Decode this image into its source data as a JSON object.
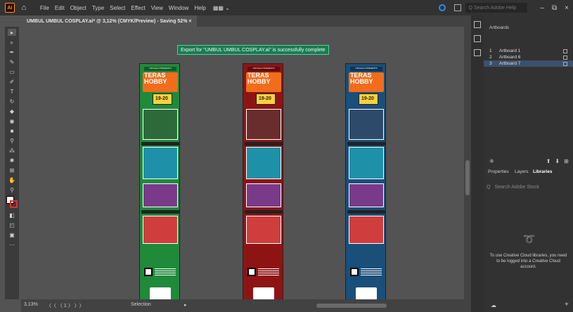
{
  "app": {
    "name": "Adobe Illustrator",
    "logo_text": "Ai",
    "brand_color": "#ff9a00"
  },
  "menubar": {
    "items": [
      "File",
      "Edit",
      "Object",
      "Type",
      "Select",
      "Effect",
      "View",
      "Window",
      "Help"
    ],
    "workspace_label": "▦▦ ⌄",
    "search_placeholder": "Search Adobe Help"
  },
  "document": {
    "tab_title": "UMBUL UMBUL COSPLAY.ai* @ 3,12% (CMYK/Preview)  - Saving 52% ×"
  },
  "notification": {
    "text": "Export for \"UMBUL UMBUL COSPLAY.ai\" is successfully complete"
  },
  "artboards_on_canvas": [
    {
      "color": "#1f8a3a",
      "header": "CIRCLE-D PRESENTS",
      "logo": "TERAS HOBBY",
      "date": "19-20"
    },
    {
      "color": "#8e1414",
      "header": "CIRCLE-D PRESENTS",
      "logo": "TERAS HOBBY",
      "date": "19-20"
    },
    {
      "color": "#1a4f7a",
      "header": "CIRCLE-D PRESENTS",
      "logo": "TERAS HOBBY",
      "date": "19-20"
    }
  ],
  "statusbar": {
    "zoom": "3,13%",
    "page_nav": "〈〈 〈 1 〉 〉〉",
    "tool": "Selection",
    "arrow": "▸"
  },
  "panel": {
    "artboards_title": "Artboards",
    "artboards": [
      {
        "num": "1",
        "name": "Artboard 1",
        "active": false
      },
      {
        "num": "2",
        "name": "Artboard 6",
        "active": false
      },
      {
        "num": "3",
        "name": "Artboard 7",
        "active": true
      }
    ],
    "tabs": [
      "Properties",
      "Layers",
      "Libraries"
    ],
    "active_tab": "Libraries",
    "libraries_search_placeholder": "Search Adobe Stock",
    "cc_message": "To use Creative Cloud libraries, you need to be logged into a Creative Cloud account."
  }
}
